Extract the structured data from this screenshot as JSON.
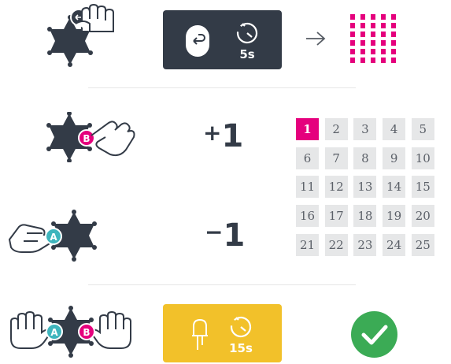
{
  "colors": {
    "board": "#333b47",
    "magenta": "#e5007d",
    "cyan": "#3eb5bd",
    "yellow": "#f2c12a",
    "green": "#3bab55",
    "cell_bg": "#e6e7e8"
  },
  "row_hold_reset": {
    "icon": "hand-pressing-reset-button-icon",
    "panel": {
      "icons": [
        "reset-button-icon",
        "timer-icon"
      ],
      "duration": "5s"
    },
    "arrow": "→",
    "result_icon": "led-matrix-icon"
  },
  "row_button_b": {
    "icon": "hand-pressing-b-button-icon",
    "button_label": "B",
    "sign": "+",
    "value": "1"
  },
  "row_button_a": {
    "icon": "hand-pressing-a-button-icon",
    "button_label": "A",
    "sign": "−",
    "value": "1"
  },
  "grid": {
    "selected": "1",
    "cells": [
      "1",
      "2",
      "3",
      "4",
      "5",
      "6",
      "7",
      "8",
      "9",
      "10",
      "11",
      "12",
      "13",
      "14",
      "15",
      "16",
      "17",
      "18",
      "19",
      "20",
      "21",
      "22",
      "23",
      "24",
      "25"
    ]
  },
  "row_confirm": {
    "icon": "hands-pressing-a-and-b-buttons-icon",
    "a_label": "A",
    "b_label": "B",
    "panel": {
      "icons": [
        "led-icon",
        "timer-icon"
      ],
      "duration": "15s"
    },
    "result_icon": "checkmark-icon"
  }
}
